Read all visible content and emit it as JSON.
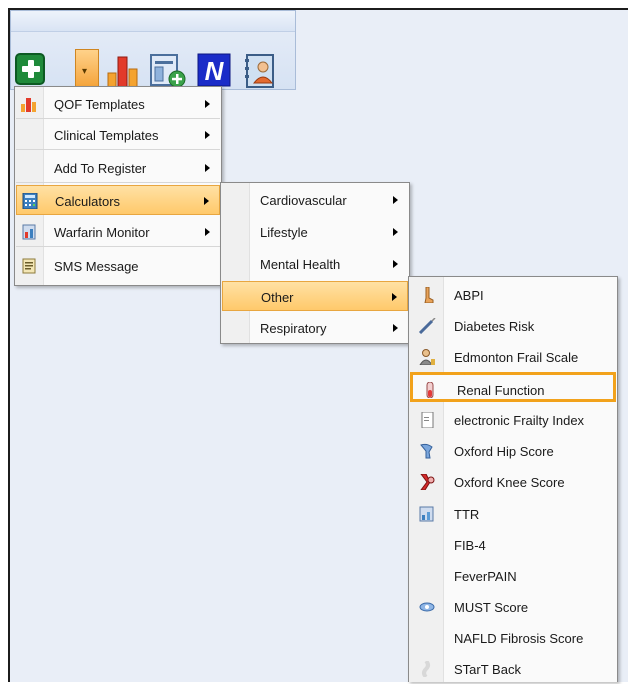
{
  "toolbar": {
    "buttons": [
      {
        "name": "add-consultation",
        "icon": "green-plus-icon"
      },
      {
        "name": "dropdown",
        "icon": "dropdown-arrow-icon"
      },
      {
        "name": "qof",
        "icon": "bar-chart-icon"
      },
      {
        "name": "template",
        "icon": "form-add-icon"
      },
      {
        "name": "n",
        "icon": "n-logo-icon"
      },
      {
        "name": "contacts",
        "icon": "address-book-icon"
      }
    ]
  },
  "menu1": {
    "items": [
      {
        "label": "QOF Templates",
        "icon": "bar-chart-icon",
        "submenu": true
      },
      {
        "label": "Clinical Templates",
        "submenu": true
      },
      {
        "label": "Add To Register",
        "submenu": true
      },
      {
        "label": "Calculators",
        "icon": "calculator-icon",
        "submenu": true,
        "highlighted": true
      },
      {
        "label": "Warfarin Monitor",
        "icon": "warfarin-icon",
        "submenu": true
      },
      {
        "label": "SMS Message",
        "icon": "sms-icon",
        "submenu": false
      }
    ]
  },
  "menu2": {
    "items": [
      {
        "label": "Cardiovascular",
        "submenu": true
      },
      {
        "label": "Lifestyle",
        "submenu": true
      },
      {
        "label": "Mental Health",
        "submenu": true
      },
      {
        "label": "Other",
        "submenu": true,
        "highlighted": true
      },
      {
        "label": "Respiratory",
        "submenu": true
      }
    ]
  },
  "menu3": {
    "items": [
      {
        "label": "ABPI",
        "icon": "leg-icon"
      },
      {
        "label": "Diabetes Risk",
        "icon": "syringe-icon"
      },
      {
        "label": "Edmonton Frail Scale",
        "icon": "elderly-person-icon"
      },
      {
        "label": "Renal Function",
        "icon": "test-tube-icon",
        "focused": true
      },
      {
        "label": "electronic Frailty Index",
        "icon": "document-icon"
      },
      {
        "label": "Oxford Hip Score",
        "icon": "hip-icon"
      },
      {
        "label": "Oxford Knee Score",
        "icon": "knee-icon"
      },
      {
        "label": "TTR",
        "icon": "ttr-icon"
      },
      {
        "label": "FIB-4",
        "icon": ""
      },
      {
        "label": "FeverPAIN",
        "icon": ""
      },
      {
        "label": "MUST Score",
        "icon": "must-icon"
      },
      {
        "label": "NAFLD Fibrosis Score",
        "icon": ""
      },
      {
        "label": "STarT Back",
        "icon": "spine-icon"
      }
    ]
  },
  "colors": {
    "highlight": "#ffc96b",
    "focus_border": "#f2a21b",
    "toolbar_bg": "#d6e2f3"
  }
}
